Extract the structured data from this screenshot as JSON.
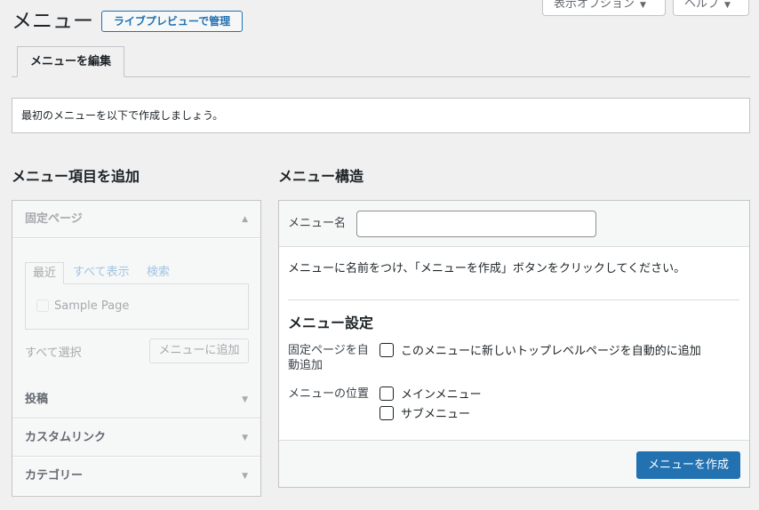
{
  "header": {
    "title": "メニュー",
    "live_preview_button": "ライブプレビューで管理",
    "screen_options": "表示オプション",
    "help": "ヘルプ"
  },
  "tabs": [
    {
      "label": "メニューを編集",
      "active": true
    }
  ],
  "notice": "最初のメニューを以下で作成しましょう。",
  "add_items": {
    "heading": "メニュー項目を追加",
    "sections": [
      {
        "label": "固定ページ",
        "expanded": true
      },
      {
        "label": "投稿",
        "expanded": false
      },
      {
        "label": "カスタムリンク",
        "expanded": false
      },
      {
        "label": "カテゴリー",
        "expanded": false
      }
    ],
    "pages_panel": {
      "tabs": [
        "最近",
        "すべて表示",
        "検索"
      ],
      "items": [
        "Sample Page"
      ],
      "select_all": "すべて選択",
      "add_button": "メニューに追加"
    }
  },
  "structure": {
    "heading": "メニュー構造",
    "name_label": "メニュー名",
    "name_value": "",
    "instructions": "メニューに名前をつけ、「メニューを作成」ボタンをクリックしてください。",
    "settings_heading": "メニュー設定",
    "auto_add_label": "固定ページを自動追加",
    "auto_add_option": "このメニューに新しいトップレベルページを自動的に追加",
    "location_label": "メニューの位置",
    "locations": [
      "メインメニュー",
      "サブメニュー"
    ],
    "create_button": "メニューを作成"
  },
  "colors": {
    "accent": "#2271b1",
    "background": "#f0f0f1",
    "panel": "#ffffff",
    "muted_text": "#a7aaad"
  },
  "icons": {
    "expanded_arrow": "triangle-up-icon",
    "collapsed_arrow": "triangle-down-icon",
    "dropdown_caret": "caret-down-icon"
  }
}
